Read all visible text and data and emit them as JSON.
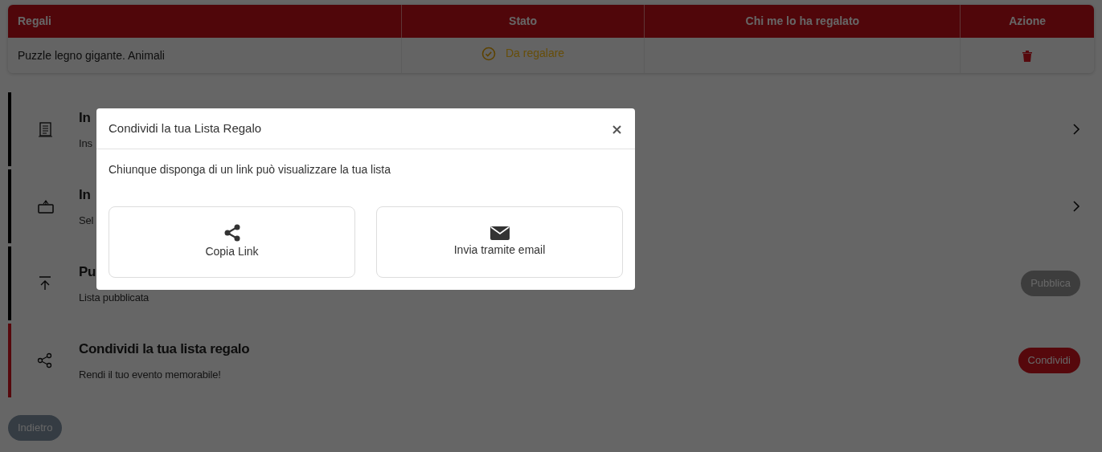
{
  "table": {
    "columns": [
      "Regali",
      "Stato",
      "Chi me lo ha regalato",
      "Azione"
    ],
    "rows": [
      {
        "gift": "Puzzle legno gigante. Animali",
        "status": "Da regalare"
      }
    ]
  },
  "steps": [
    {
      "title": "In",
      "subtitle": "Ins",
      "current": false,
      "action": {
        "kind": "chevron"
      }
    },
    {
      "title": "In",
      "subtitle": "Sel",
      "current": false,
      "action": {
        "kind": "chevron"
      }
    },
    {
      "title": "Pu",
      "subtitle": "Lista pubblicata",
      "current": false,
      "action": {
        "kind": "button",
        "label": "Pubblica",
        "disabled": true
      }
    },
    {
      "title": "Condividi la tua lista regalo",
      "subtitle": "Rendi il tuo evento memorabile!",
      "current": true,
      "action": {
        "kind": "button",
        "label": "Condividi",
        "disabled": false
      }
    }
  ],
  "back_button": {
    "label": "Indietro",
    "disabled": true
  },
  "modal": {
    "title": "Condividi la tua Lista Regalo",
    "text": "Chiunque disponga di un link può visualizzare la tua lista",
    "options": [
      {
        "kind": "share",
        "label": "Copia Link"
      },
      {
        "kind": "email",
        "label": "Invia tramite email"
      }
    ]
  }
}
